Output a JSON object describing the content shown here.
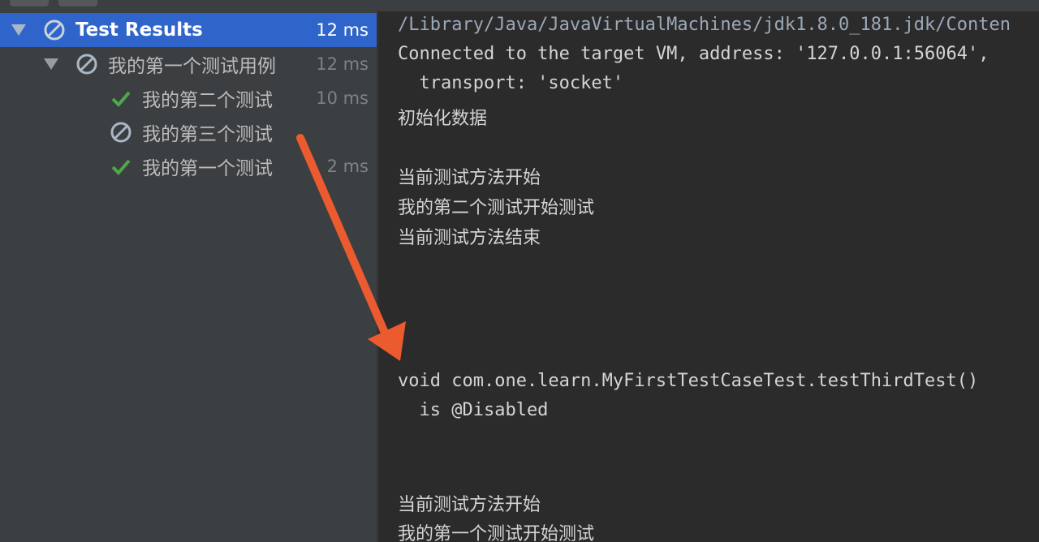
{
  "tree": {
    "root": {
      "label": "Test Results",
      "time": "12 ms"
    },
    "suite": {
      "label": "我的第一个测试用例",
      "time": "12 ms"
    },
    "tests": [
      {
        "label": "我的第二个测试",
        "time": "10 ms",
        "status": "passed"
      },
      {
        "label": "我的第三个测试",
        "time": "",
        "status": "disabled"
      },
      {
        "label": "我的第一个测试",
        "time": "2 ms",
        "status": "passed"
      }
    ]
  },
  "console": {
    "lines": [
      "/Library/Java/JavaVirtualMachines/jdk1.8.0_181.jdk/Conten",
      "Connected to the target VM, address: '127.0.0.1:56064',",
      "  transport: 'socket'",
      "初始化数据",
      "当前测试方法开始",
      "我的第二个测试开始测试",
      "当前测试方法结束",
      "void com.one.learn.MyFirstTestCaseTest.testThirdTest()",
      "  is @Disabled",
      "当前测试方法开始",
      "我的第一个测试开始测试"
    ]
  },
  "colors": {
    "selection": "#2f65ca",
    "passed": "#4fa84a",
    "disabled": "#a9b7c6",
    "annotation_arrow": "#ec5a2f"
  },
  "icons": {
    "root": "disabled-icon",
    "suite": "disabled-icon",
    "passed": "check-icon",
    "disabled": "disabled-icon",
    "expander": "triangle-down-icon"
  }
}
